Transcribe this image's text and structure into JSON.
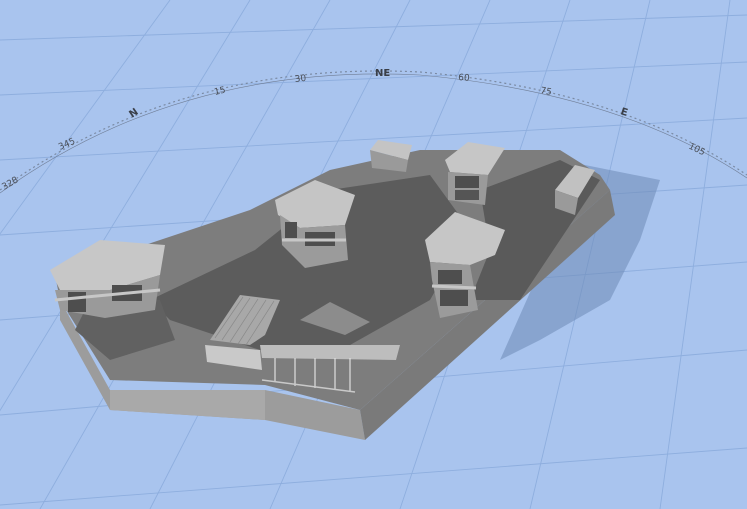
{
  "viewport": {
    "name": "3D model view",
    "background_color": "#a9c4ee",
    "grid_color": "#8eaede",
    "terrain_top_color": "#7d7d7d",
    "shadow_color": "#5a5a5a",
    "terrain_side_color": "#9c9c9c",
    "building_color": "#b9b9b9"
  },
  "compass": {
    "labels": [
      "328",
      "345",
      "N",
      "15",
      "30",
      "NE",
      "60",
      "75",
      "E",
      "105"
    ]
  }
}
